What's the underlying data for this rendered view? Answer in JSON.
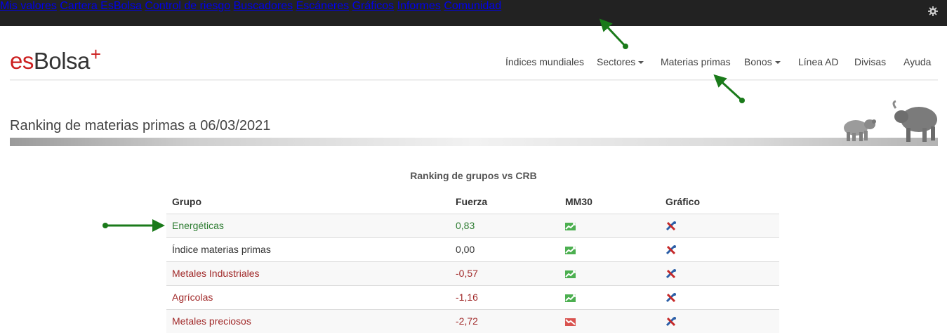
{
  "topnav": {
    "items": [
      "Mis valores",
      "Cartera EsBolsa",
      "Control de riesgo",
      "Buscadores",
      "Escáneres",
      "Gráficos",
      "Informes",
      "Comunidad"
    ],
    "settings_icon": "gear-icon"
  },
  "brand": {
    "es": "es",
    "bolsa": "Bolsa",
    "plus": "+"
  },
  "subnav": {
    "items": [
      "Índices mundiales",
      "Sectores",
      "Materias primas",
      "Bonos",
      "Línea AD",
      "Divisas",
      "Ayuda"
    ]
  },
  "page": {
    "title": "Ranking de materias primas a 06/03/2021"
  },
  "table": {
    "title": "Ranking de grupos vs CRB",
    "headers": [
      "Grupo",
      "Fuerza",
      "MM30",
      "Gráfico"
    ],
    "rows": [
      {
        "grupo": "Energéticas",
        "fuerza": "0,83",
        "mm30": "trend-up-icon",
        "grafico": "chart-tool-icon",
        "tone": "pos"
      },
      {
        "grupo": "Índice materias primas",
        "fuerza": "0,00",
        "mm30": "trend-up-icon",
        "grafico": "chart-tool-icon",
        "tone": "neu"
      },
      {
        "grupo": "Metales Industriales",
        "fuerza": "-0,57",
        "mm30": "trend-up-icon",
        "grafico": "chart-tool-icon",
        "tone": "neg"
      },
      {
        "grupo": "Agrícolas",
        "fuerza": "-1,16",
        "mm30": "trend-up-icon",
        "grafico": "chart-tool-icon",
        "tone": "neg"
      },
      {
        "grupo": "Metales preciosos",
        "fuerza": "-2,72",
        "mm30": "trend-down-icon",
        "grafico": "chart-tool-icon",
        "tone": "neg"
      }
    ]
  },
  "colors": {
    "topbar": "#222222",
    "brand_red": "#cc1f1f",
    "positive": "#2e7d32",
    "negative": "#a12a2a",
    "annotation_arrow": "#1a7a1a"
  }
}
